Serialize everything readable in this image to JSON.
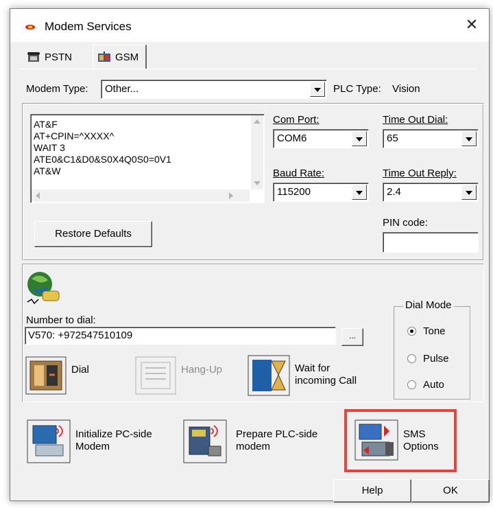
{
  "window": {
    "title": "Modem Services",
    "close_glyph": "✕"
  },
  "tabs": [
    {
      "label": "PSTN",
      "icon": "phone-icon"
    },
    {
      "label": "GSM",
      "icon": "gsm-icon",
      "selected": true
    }
  ],
  "top": {
    "modem_type_label": "Modem Type:",
    "modem_type_value": "Other...",
    "plc_type_label": "PLC Type:",
    "plc_type_value": "Vision"
  },
  "init_commands": [
    "AT&F",
    "AT+CPIN=^XXXX^",
    "WAIT 3",
    "ATE0&C1&D0&S0X4Q0S0=0V1",
    "AT&W"
  ],
  "restore_defaults_label": "Restore Defaults",
  "com_port": {
    "label": "Com Port:",
    "value": "COM6"
  },
  "baud_rate": {
    "label": "Baud Rate:",
    "value": "115200"
  },
  "timeout_dial": {
    "label": "Time Out Dial:",
    "value": "65"
  },
  "timeout_reply": {
    "label": "Time Out Reply:",
    "value": "2.4"
  },
  "pin_code": {
    "label": "PIN code:",
    "value": ""
  },
  "dial": {
    "number_label": "Number to dial:",
    "number_value": "V570: +972547510109",
    "browse_label": "...",
    "dial_label": "Dial",
    "hangup_label": "Hang-Up",
    "wait_label_1": "Wait for",
    "wait_label_2": "incoming Call"
  },
  "dial_mode": {
    "legend": "Dial Mode",
    "options": [
      {
        "label": "Tone",
        "selected": true
      },
      {
        "label": "Pulse",
        "selected": false
      },
      {
        "label": "Auto",
        "selected": false
      }
    ]
  },
  "actions": {
    "init_pc_1": "Initialize PC-side",
    "init_pc_2": "Modem",
    "prepare_plc_1": "Prepare PLC-side",
    "prepare_plc_2": "modem",
    "sms_1": "SMS",
    "sms_2": "Options"
  },
  "footer": {
    "help_label": "Help",
    "ok_label": "OK"
  },
  "colors": {
    "highlight": "#e8423e",
    "dialog_bg": "#f0f0f0"
  }
}
